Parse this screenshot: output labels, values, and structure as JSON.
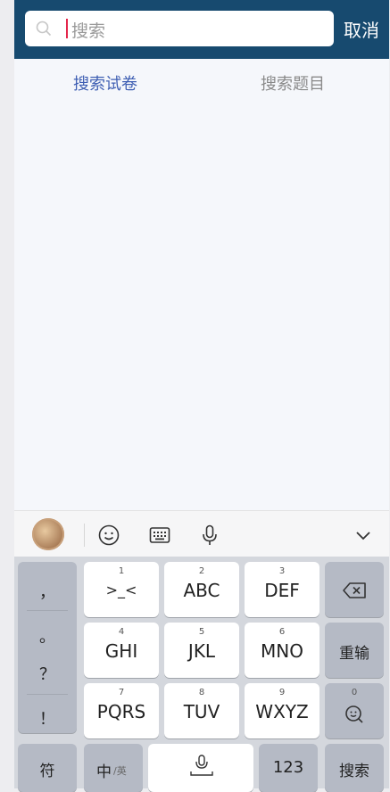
{
  "search": {
    "placeholder": "搜索",
    "cancel_label": "取消"
  },
  "tabs": [
    {
      "label": "搜索试卷",
      "active": true
    },
    {
      "label": "搜索题目",
      "active": false
    }
  ],
  "keyboard_toolbar": {
    "icons": [
      "avatar",
      "emoji-icon",
      "keyboard-icon",
      "microphone-icon",
      "chevron-down-icon"
    ]
  },
  "keyboard": {
    "punctuation": [
      "，",
      "。",
      "？",
      "！"
    ],
    "keys": [
      {
        "num": "1",
        "label": ">_<"
      },
      {
        "num": "2",
        "label": "ABC"
      },
      {
        "num": "3",
        "label": "DEF"
      },
      {
        "num": "4",
        "label": "GHI"
      },
      {
        "num": "5",
        "label": "JKL"
      },
      {
        "num": "6",
        "label": "MNO"
      },
      {
        "num": "7",
        "label": "PQRS"
      },
      {
        "num": "8",
        "label": "TUV"
      },
      {
        "num": "9",
        "label": "WXYZ"
      }
    ],
    "reinput_label": "重输",
    "smart_num": "0",
    "bottom": {
      "symbol_label": "符",
      "lang_label": "中",
      "lang_sub": "/英",
      "num_label": "123",
      "search_label": "搜索"
    }
  },
  "colors": {
    "header_bg": "#174a6f",
    "active_tab": "#3f5fb3",
    "cursor": "#e4264b"
  }
}
